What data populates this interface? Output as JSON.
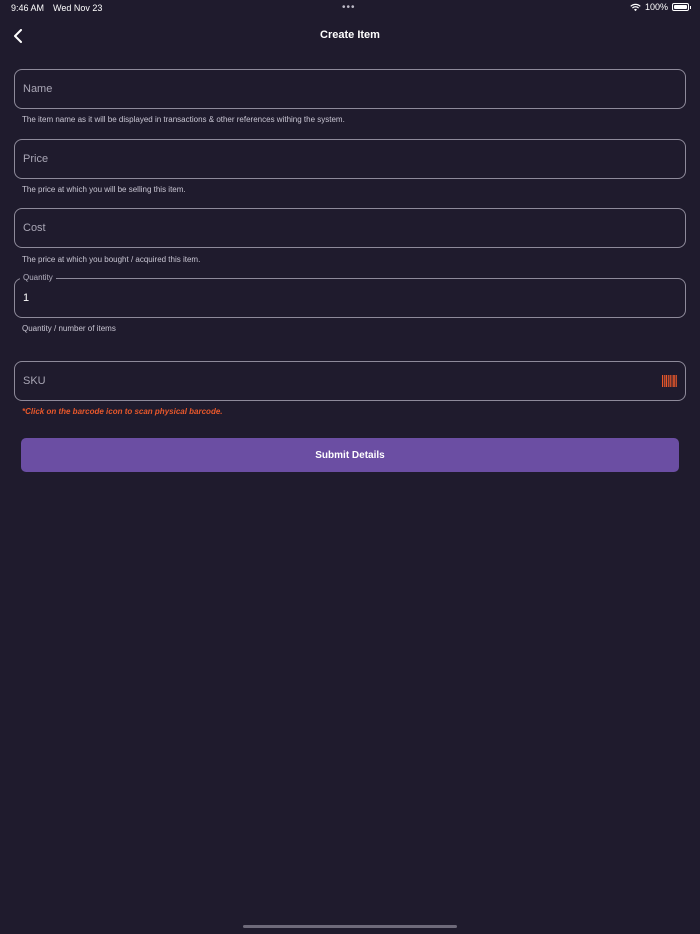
{
  "status_bar": {
    "time": "9:46 AM",
    "date": "Wed Nov 23",
    "dots": "•••",
    "battery": "100%"
  },
  "nav": {
    "title": "Create Item",
    "back_icon": "chevron-left-icon"
  },
  "form": {
    "name": {
      "placeholder": "Name",
      "value": "",
      "helper": "The item name as it will be displayed in transactions & other references withing the system."
    },
    "price": {
      "placeholder": "Price",
      "value": "",
      "helper": "The price at which you will be selling this item."
    },
    "cost": {
      "placeholder": "Cost",
      "value": "",
      "helper": "The price at which you bought / acquired this item."
    },
    "quantity": {
      "label": "Quantity",
      "value": "1",
      "helper": "Quantity / number of items"
    },
    "sku": {
      "placeholder": "SKU",
      "value": "",
      "helper": "*Click on the barcode icon to scan physical barcode.",
      "icon": "barcode-icon"
    }
  },
  "submit": {
    "label": "Submit Details"
  },
  "colors": {
    "background": "#1f1b2d",
    "accent": "#6b4ea3",
    "warning": "#e9582b"
  }
}
